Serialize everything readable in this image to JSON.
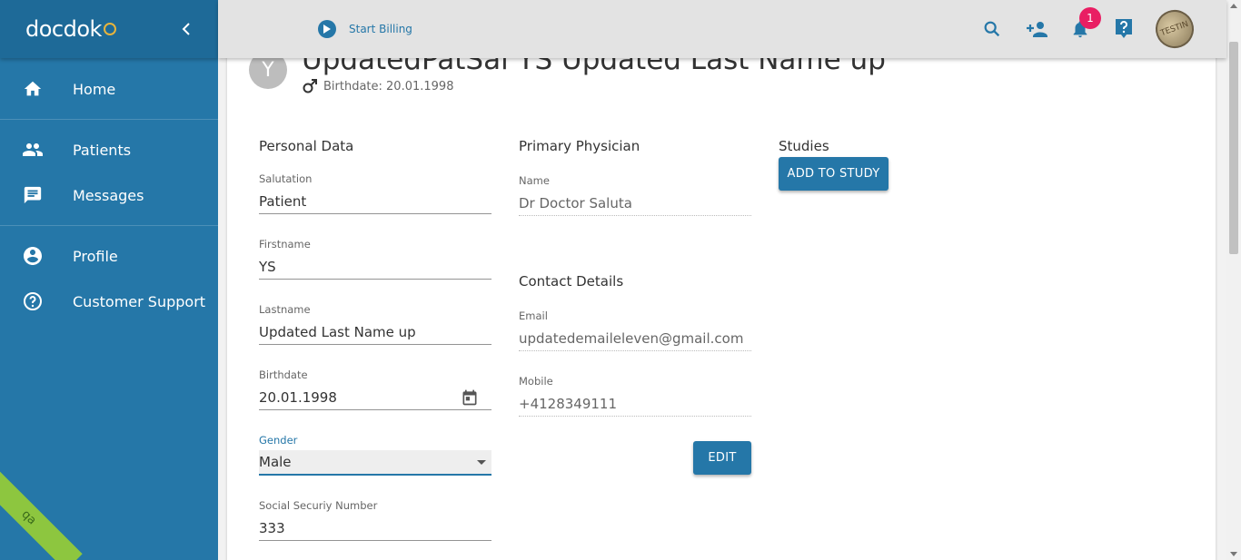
{
  "app": {
    "logo": "docdok",
    "qa_label": "qa"
  },
  "sidebar": {
    "items": [
      {
        "label": "Home",
        "icon": "home-icon"
      },
      {
        "label": "Patients",
        "icon": "people-icon"
      },
      {
        "label": "Messages",
        "icon": "message-icon"
      },
      {
        "label": "Profile",
        "icon": "account-circle-icon"
      },
      {
        "label": "Customer Support",
        "icon": "help-circle-icon"
      }
    ]
  },
  "topbar": {
    "billing_label": "Start Billing",
    "notification_count": "1",
    "avatar_text": "TESTIN"
  },
  "patient": {
    "avatar_letter": "Y",
    "name": "UpdatedPatSal YS Updated Last Name up",
    "birthdate_line": "Birthdate: 20.01.1998"
  },
  "personal_data": {
    "title": "Personal Data",
    "salutation": {
      "label": "Salutation",
      "value": "Patient"
    },
    "firstname": {
      "label": "Firstname",
      "value": "YS"
    },
    "lastname": {
      "label": "Lastname",
      "value": "Updated Last Name up"
    },
    "birthdate": {
      "label": "Birthdate",
      "value": "20.01.1998"
    },
    "gender": {
      "label": "Gender",
      "value": "Male"
    },
    "ssn": {
      "label": "Social Securiy Number",
      "value": "333"
    }
  },
  "primary_physician": {
    "title": "Primary Physician",
    "name": {
      "label": "Name",
      "value": "Dr Doctor Saluta"
    }
  },
  "contact_details": {
    "title": "Contact Details",
    "email": {
      "label": "Email",
      "value": "updatedemaileleven@gmail.com"
    },
    "mobile": {
      "label": "Mobile",
      "value": "+4128349111"
    },
    "edit_label": "EDIT"
  },
  "studies": {
    "title": "Studies",
    "add_label": "ADD TO STUDY"
  },
  "colors": {
    "primary": "#2577a8",
    "badge": "#e91e63",
    "qa": "#8dc63f"
  }
}
